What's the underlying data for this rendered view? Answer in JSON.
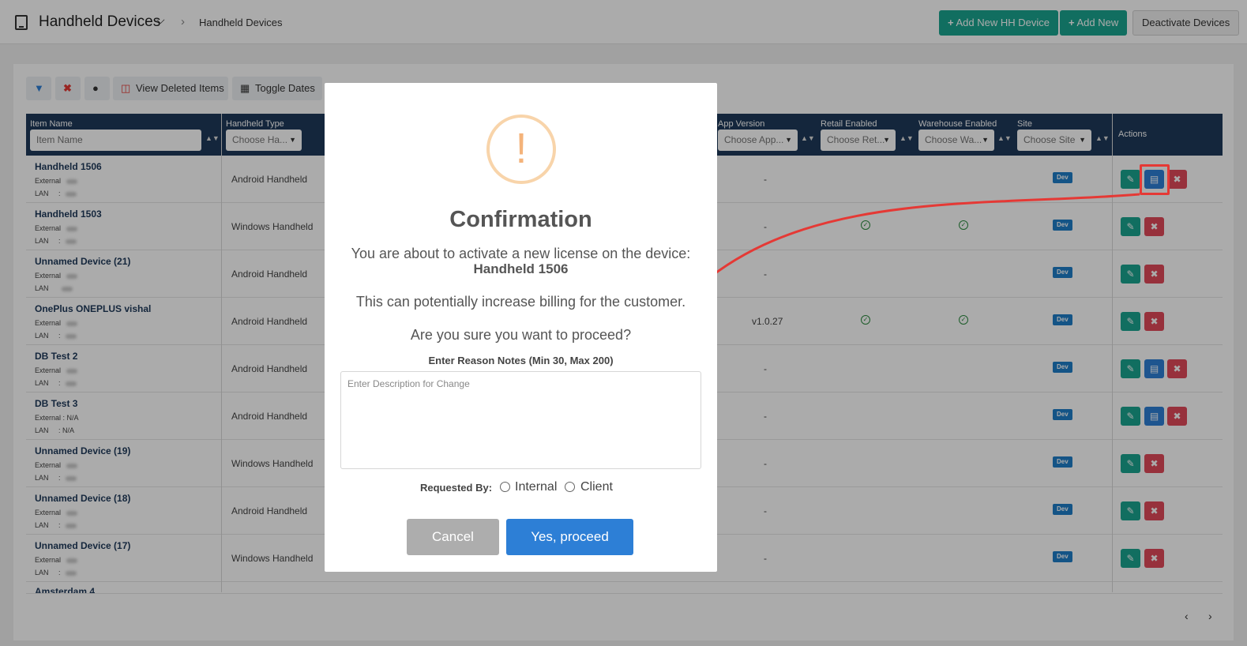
{
  "header": {
    "title": "Handheld Devices",
    "breadcrumb": "Handheld Devices",
    "add_hh_label": "Add New HH Device",
    "add_new_label": "Add New",
    "deactivate_label": "Deactivate Devices"
  },
  "toolbar": {
    "view_deleted_label": "View Deleted Items",
    "toggle_dates_label": "Toggle Dates"
  },
  "table": {
    "headers": {
      "item_name": "Item Name",
      "handheld_type": "Handheld Type",
      "app_version": "App Version",
      "retail_enabled": "Retail Enabled",
      "warehouse_enabled": "Warehouse Enabled",
      "site": "Site",
      "actions": "Actions"
    },
    "filters": {
      "item_name_placeholder": "Item Name",
      "handheld_type": "Choose Ha...",
      "app_version": "Choose App...",
      "retail_enabled": "Choose Ret...",
      "warehouse_enabled": "Choose Wa...",
      "site": "Choose Site"
    },
    "external_label": "External",
    "lan_label": "LAN",
    "rows": [
      {
        "name": "Handheld 1506",
        "type": "Android Handheld",
        "version": "-",
        "retail": false,
        "warehouse": false,
        "site": "Dev",
        "license": true,
        "ext": "",
        "lan": ": "
      },
      {
        "name": "Handheld 1503",
        "type": "Windows Handheld",
        "version": "-",
        "retail": true,
        "warehouse": true,
        "site": "Dev",
        "license": false,
        "ext": "",
        "lan": ": "
      },
      {
        "name": "Unnamed Device (21)",
        "type": "Android Handheld",
        "version": "-",
        "retail": false,
        "warehouse": false,
        "site": "Dev",
        "license": false,
        "ext": "",
        "lan": ""
      },
      {
        "name": "OnePlus ONEPLUS vishal",
        "type": "Android Handheld",
        "version": "v1.0.27",
        "retail": true,
        "warehouse": true,
        "site": "Dev",
        "license": false,
        "ext": "",
        "lan": ": "
      },
      {
        "name": "DB Test 2",
        "type": "Android Handheld",
        "version": "-",
        "retail": false,
        "warehouse": false,
        "site": "Dev",
        "license": true,
        "ext": "",
        "lan": ": "
      },
      {
        "name": "DB Test 3",
        "type": "Android Handheld",
        "version": "-",
        "retail": false,
        "warehouse": false,
        "site": "Dev",
        "license": true,
        "ext": ": N/A",
        "lan": ": N/A"
      },
      {
        "name": "Unnamed Device (19)",
        "type": "Windows Handheld",
        "version": "-",
        "retail": false,
        "warehouse": false,
        "site": "Dev",
        "license": false,
        "ext": "",
        "lan": ": "
      },
      {
        "name": "Unnamed Device (18)",
        "type": "Android Handheld",
        "version": "-",
        "retail": false,
        "warehouse": false,
        "site": "Dev",
        "license": false,
        "ext": "",
        "lan": ": "
      },
      {
        "name": "Unnamed Device (17)",
        "type": "Windows Handheld",
        "version": "-",
        "retail": false,
        "warehouse": false,
        "site": "Dev",
        "license": false,
        "ext": "",
        "lan": ": "
      }
    ],
    "partial_row_name": "Amsterdam 4"
  },
  "modal": {
    "icon": "exclamation-icon",
    "title": "Confirmation",
    "line1": "You are about to activate a new license on the device:",
    "device": "Handheld 1506",
    "line2": "This can potentially increase billing for the customer.",
    "line3": "Are you sure you want to proceed?",
    "notes_label": "Enter Reason Notes (Min 30, Max 200)",
    "notes_placeholder": "Enter Description for Change",
    "notes_value": "",
    "requested_by_label": "Requested By:",
    "options": [
      "Internal",
      "Client"
    ],
    "cancel_label": "Cancel",
    "confirm_label": "Yes, proceed"
  },
  "colors": {
    "accent": "#1aa58f",
    "header_bg": "#1f3a5a",
    "primary": "#2d7fd6",
    "danger": "#e24a5a",
    "warning": "#f4b37a",
    "annotation": "#e53935"
  }
}
